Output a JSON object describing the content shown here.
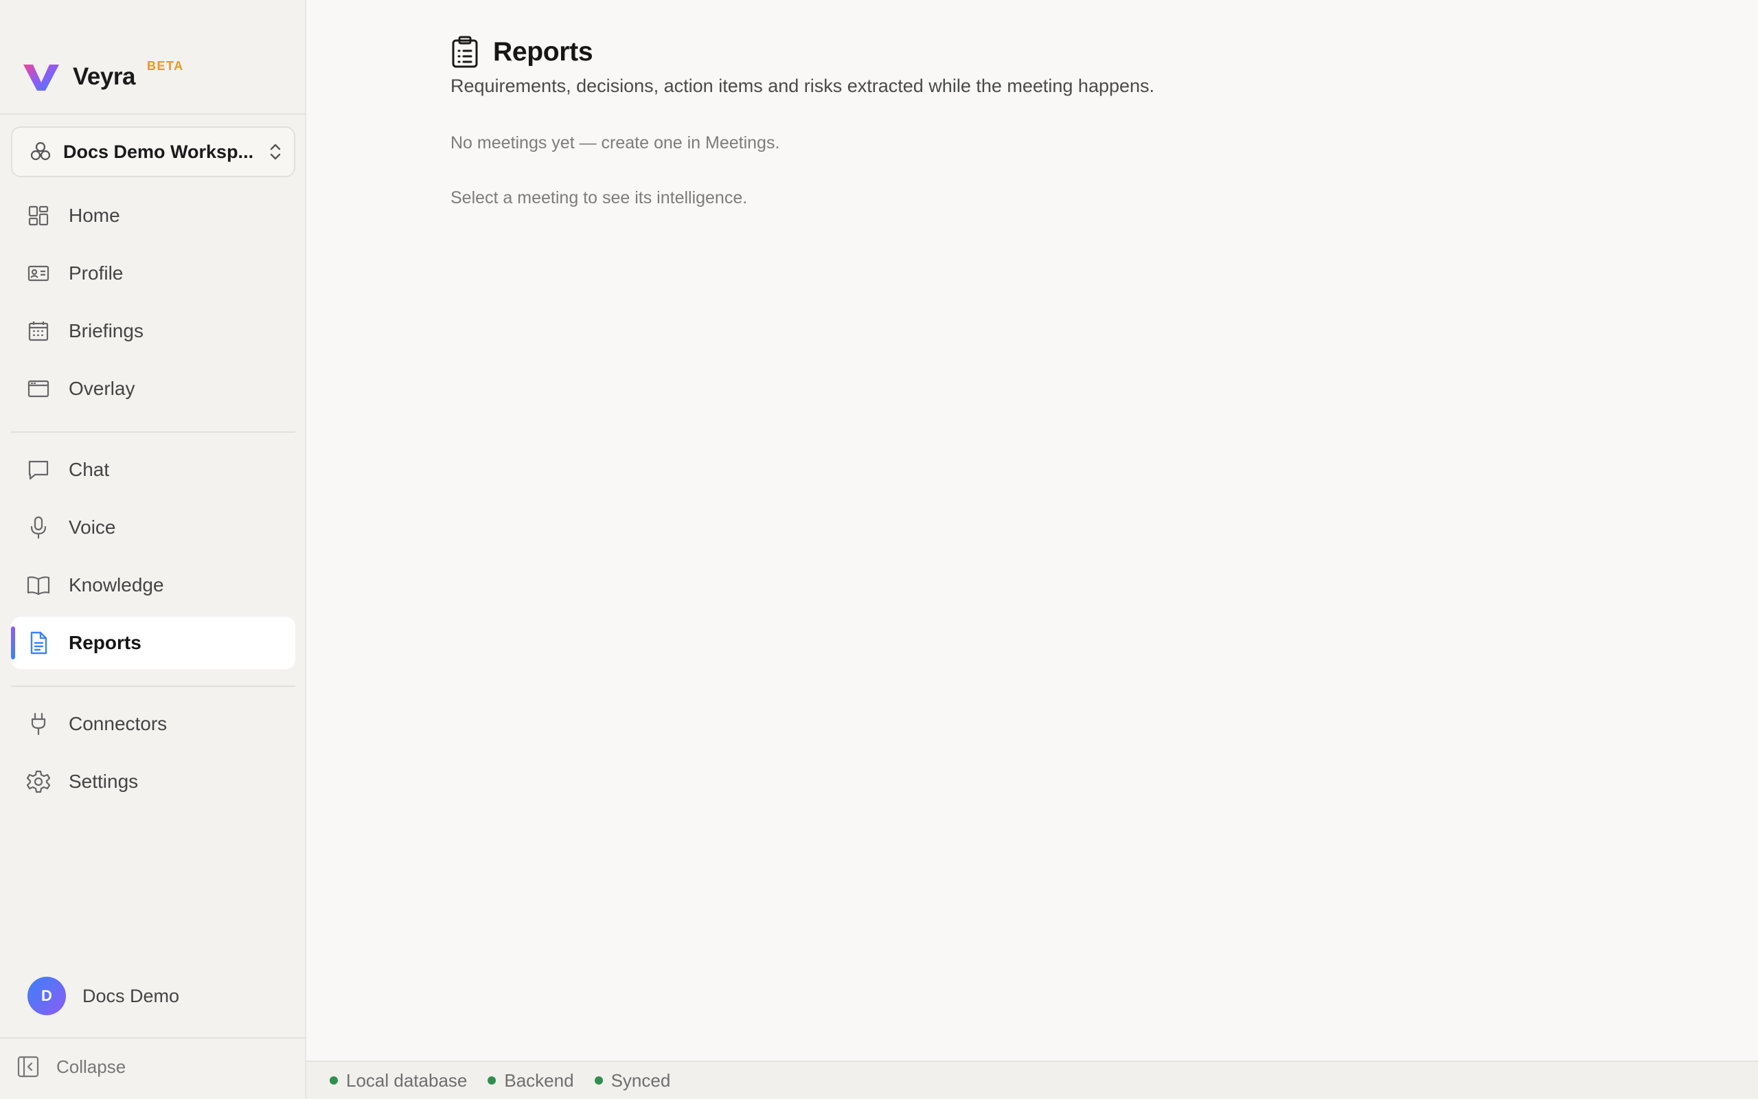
{
  "app": {
    "name": "Veyra",
    "badge": "BETA"
  },
  "workspace": {
    "name": "Docs Demo Worksp..."
  },
  "nav": {
    "groups": [
      [
        {
          "label": "Home",
          "icon": "grid-icon"
        },
        {
          "label": "Profile",
          "icon": "id-card-icon"
        },
        {
          "label": "Briefings",
          "icon": "calendar-icon"
        },
        {
          "label": "Overlay",
          "icon": "window-icon"
        }
      ],
      [
        {
          "label": "Chat",
          "icon": "chat-bubble-icon"
        },
        {
          "label": "Voice",
          "icon": "microphone-icon"
        },
        {
          "label": "Knowledge",
          "icon": "book-icon"
        },
        {
          "label": "Reports",
          "icon": "document-icon",
          "active": true
        }
      ],
      [
        {
          "label": "Connectors",
          "icon": "plug-icon"
        },
        {
          "label": "Settings",
          "icon": "gear-icon"
        }
      ]
    ]
  },
  "user": {
    "initial": "D",
    "name": "Docs Demo"
  },
  "sidebar_footer": {
    "collapse_label": "Collapse"
  },
  "page": {
    "icon": "clipboard-list-icon",
    "title": "Reports",
    "subtitle": "Requirements, decisions, action items and risks extracted while the meeting happens.",
    "empty_meetings": "No meetings yet — create one in Meetings.",
    "select_hint": "Select a meeting to see its intelligence."
  },
  "status": [
    {
      "label": "Local database",
      "color": "#2f8f4e"
    },
    {
      "label": "Backend",
      "color": "#2f8f4e"
    },
    {
      "label": "Synced",
      "color": "#2f8f4e"
    }
  ],
  "colors": {
    "accent": "#3b82f6",
    "accent_purple": "#8b5cf6",
    "beta": "#e89a1b",
    "status_ok": "#2f8f4e"
  }
}
